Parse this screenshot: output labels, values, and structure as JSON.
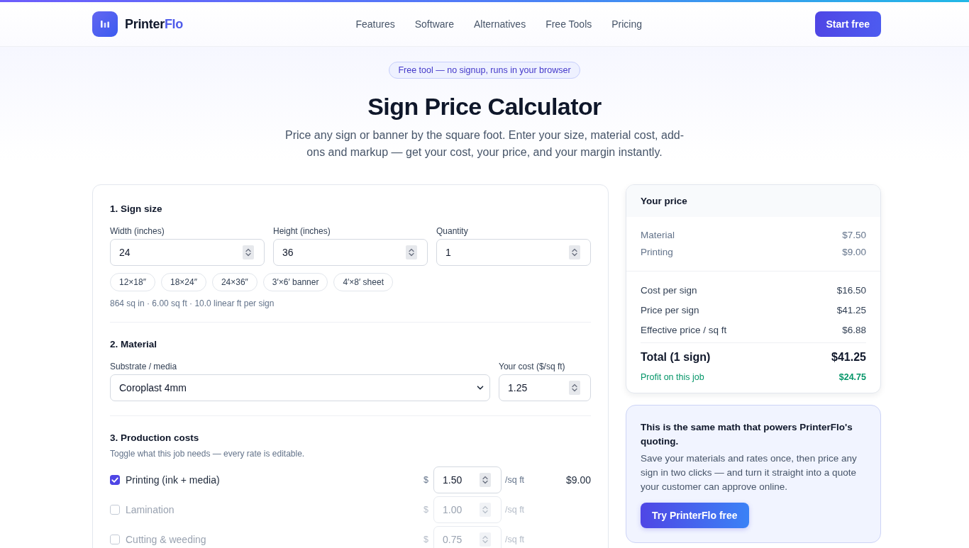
{
  "header": {
    "brand": {
      "name": "Printer",
      "accent": "Flo"
    },
    "nav": [
      "Features",
      "Software",
      "Alternatives",
      "Free Tools",
      "Pricing"
    ],
    "cta": "Start free"
  },
  "hero": {
    "badge": "Free tool — no signup, runs in your browser",
    "title": "Sign Price Calculator",
    "subtitle": "Price any sign or banner by the square foot. Enter your size, material cost, add-ons and markup — get your cost, your price, and your margin instantly."
  },
  "calculator": {
    "sections": [
      {
        "kind": "size",
        "title": "1. Sign size",
        "fields": [
          {
            "label": "Width (inches)",
            "value": "24"
          },
          {
            "label": "Height (inches)",
            "value": "36"
          },
          {
            "label": "Quantity",
            "value": "1"
          }
        ],
        "presets": [
          "12×18″",
          "18×24″",
          "24×36″",
          "3′×6′ banner",
          "4′×8′ sheet"
        ],
        "summary": "864 sq in · 6.00 sq ft · 10.0 linear ft per sign"
      },
      {
        "kind": "material",
        "title": "2. Material",
        "select": {
          "label": "Substrate / media",
          "value": "Coroplast 4mm"
        },
        "cost": {
          "label": "Your cost ($/sq ft)",
          "value": "1.25"
        }
      },
      {
        "kind": "production",
        "title": "3. Production costs",
        "hint": "Toggle what this job needs — every rate is editable.",
        "items": [
          {
            "label": "Printing (ink + media)",
            "checked": true,
            "currency": "$",
            "rate": "1.50",
            "unit": "/sq ft",
            "amount": "$9.00"
          },
          {
            "label": "Lamination",
            "checked": false,
            "currency": "$",
            "rate": "1.00",
            "unit": "/sq ft"
          },
          {
            "label": "Cutting & weeding",
            "checked": false,
            "currency": "$",
            "rate": "0.75",
            "unit": "/sq ft"
          }
        ]
      }
    ]
  },
  "price_panel": {
    "title": "Your price",
    "breakdown": [
      {
        "label": "Material",
        "value": "$7.50"
      },
      {
        "label": "Printing",
        "value": "$9.00"
      }
    ],
    "totals": [
      {
        "label": "Cost per sign",
        "value": "$16.50"
      },
      {
        "label": "Price per sign",
        "value": "$41.25"
      },
      {
        "label": "Effective price / sq ft",
        "value": "$6.88"
      }
    ],
    "total": {
      "label": "Total (1 sign)",
      "value": "$41.25"
    },
    "profit": {
      "label": "Profit on this job",
      "value": "$24.75"
    }
  },
  "promo": {
    "title": "This is the same math that powers PrinterFlo's quoting.",
    "body": "Save your materials and rates once, then price any sign in two clicks — and turn it straight into a quote your customer can approve online.",
    "button": "Try PrinterFlo free"
  }
}
